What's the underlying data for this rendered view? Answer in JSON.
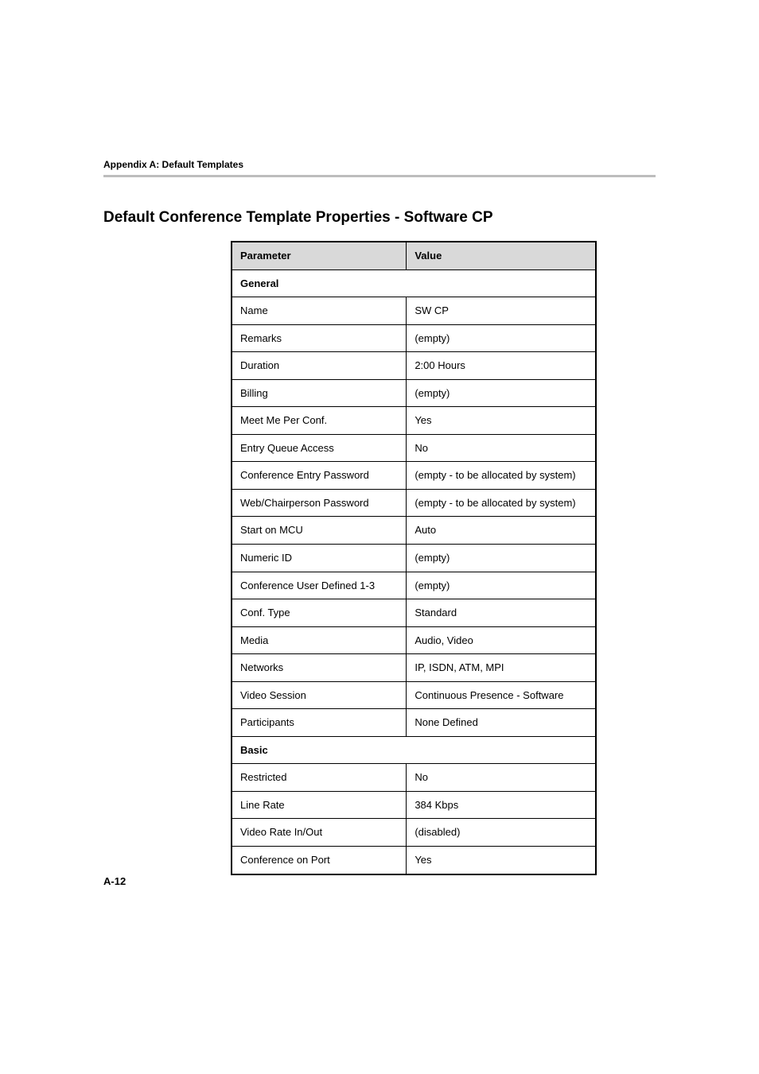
{
  "header": {
    "label": "Appendix A: Default Templates"
  },
  "title": "Default Conference Template Properties - Software CP",
  "table": {
    "head": {
      "param": "Parameter",
      "value": "Value"
    },
    "sections": [
      {
        "heading": "General",
        "rows": [
          {
            "param": "Name",
            "value": "SW CP"
          },
          {
            "param": "Remarks",
            "value": "(empty)"
          },
          {
            "param": "Duration",
            "value": "2:00 Hours"
          },
          {
            "param": "Billing",
            "value": "(empty)"
          },
          {
            "param": "Meet Me Per Conf.",
            "value": "Yes"
          },
          {
            "param": "Entry Queue Access",
            "value": "No"
          },
          {
            "param": "Conference Entry Password",
            "value": "(empty - to be allocated by system)"
          },
          {
            "param": "Web/Chairperson Password",
            "value": "(empty - to be allocated by system)"
          },
          {
            "param": "Start on MCU",
            "value": "Auto"
          },
          {
            "param": "Numeric ID",
            "value": "(empty)"
          },
          {
            "param": "Conference User Defined 1-3",
            "value": "(empty)"
          },
          {
            "param": "Conf. Type",
            "value": "Standard"
          },
          {
            "param": "Media",
            "value": "Audio, Video"
          },
          {
            "param": "Networks",
            "value": "IP, ISDN, ATM, MPI"
          },
          {
            "param": "Video Session",
            "value": "Continuous Presence - Software"
          },
          {
            "param": "Participants",
            "value": "None Defined"
          }
        ]
      },
      {
        "heading": "Basic",
        "rows": [
          {
            "param": "Restricted",
            "value": "No"
          },
          {
            "param": "Line Rate",
            "value": "384 Kbps"
          },
          {
            "param": "Video Rate In/Out",
            "value": "(disabled)"
          },
          {
            "param": "Conference on Port",
            "value": "Yes"
          }
        ]
      }
    ]
  },
  "page_number": "A-12"
}
